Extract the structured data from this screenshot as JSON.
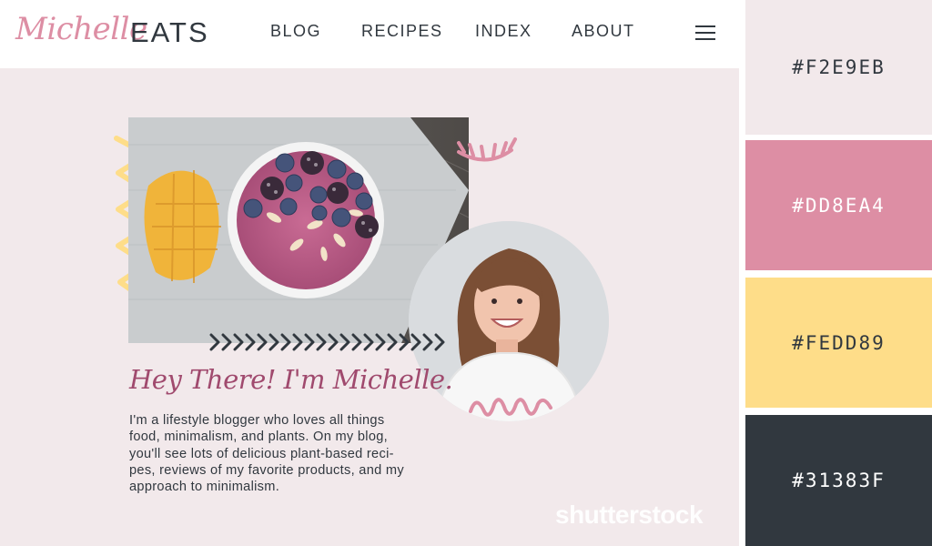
{
  "brand": {
    "script": "Michelle",
    "word": "EATS"
  },
  "nav": {
    "items": [
      "BLOG",
      "RECIPES",
      "INDEX",
      "ABOUT"
    ]
  },
  "hero": {
    "greeting": "Hey There! I'm Michelle.",
    "bio_lines": [
      "I'm a lifestyle blogger who loves all things",
      "food, minimalism, and plants. On my blog,",
      "you'll see lots of delicious plant-based reci-",
      "pes, reviews of my favorite products, and my",
      "approach to minimalism."
    ]
  },
  "watermark": "shutterstock",
  "colors": {
    "light_pink": "#F2E9EB",
    "pink": "#DD8EA4",
    "yellow": "#FEDD89",
    "dark": "#31383F",
    "plum": "#A04A6E"
  },
  "palette": [
    {
      "hex": "#F2E9EB",
      "label": "#F2E9EB",
      "text_color": "#31383F"
    },
    {
      "hex": "#DD8EA4",
      "label": "#DD8EA4",
      "text_color": "#FFFFFF"
    },
    {
      "hex": "#FEDD89",
      "label": "#FEDD89",
      "text_color": "#31383F"
    },
    {
      "hex": "#31383F",
      "label": "#31383F",
      "text_color": "#FFFFFF"
    }
  ]
}
